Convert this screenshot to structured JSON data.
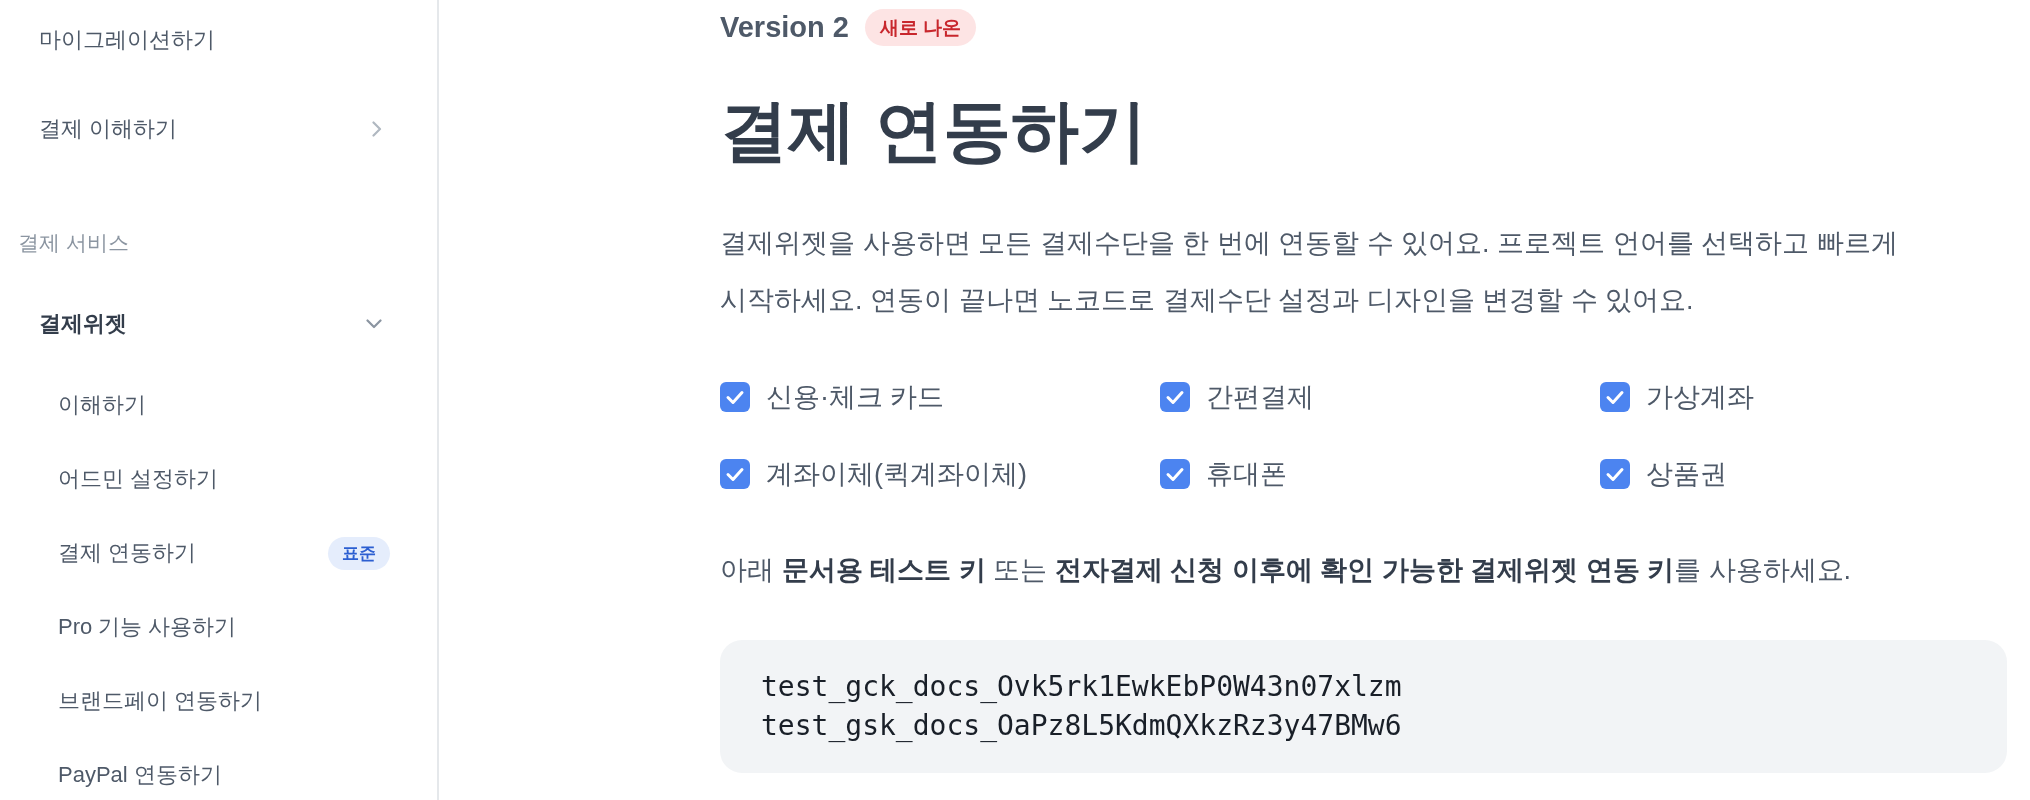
{
  "sidebar": {
    "items": [
      {
        "kind": "page",
        "label": "마이그레이션하기"
      },
      {
        "kind": "group",
        "label": "결제 이해하기",
        "expanded": false
      }
    ],
    "sections": [
      {
        "heading": "결제 서비스",
        "items": [
          {
            "kind": "group",
            "label": "결제위젯",
            "expanded": true,
            "children": [
              {
                "label": "이해하기"
              },
              {
                "label": "어드민 설정하기"
              },
              {
                "label": "결제 연동하기",
                "badge": "표준"
              },
              {
                "label": "Pro 기능 사용하기"
              },
              {
                "label": "브랜드페이 연동하기"
              },
              {
                "label": "PayPal 연동하기"
              }
            ]
          }
        ]
      }
    ]
  },
  "main": {
    "version": "Version 2",
    "version_badge": "새로 나온",
    "title": "결제 연동하기",
    "intro": "결제위젯을 사용하면 모든 결제수단을 한 번에 연동할 수 있어요. 프로젝트 언어를 선택하고 빠르게 시작하세요. 연동이 끝나면 노코드로 결제수단 설정과 디자인을 변경할 수 있어요.",
    "payment_methods": [
      {
        "label": "신용·체크 카드",
        "checked": true
      },
      {
        "label": "간편결제",
        "checked": true
      },
      {
        "label": "가상계좌",
        "checked": true
      },
      {
        "label": "계좌이체(퀵계좌이체)",
        "checked": true
      },
      {
        "label": "휴대폰",
        "checked": true
      },
      {
        "label": "상품권",
        "checked": true
      }
    ],
    "key_note": "아래 **문서용 테스트 키** 또는 **전자결제 신청 이후에 확인 가능한 결제위젯 연동 키**를 사용하세요.",
    "code_block": {
      "lines": [
        "test_gck_docs_Ovk5rk1EwkEbP0W43n07xlzm",
        "test_gsk_docs_OaPz8L5KdmQXkzRz3y47BMw6"
      ]
    }
  }
}
